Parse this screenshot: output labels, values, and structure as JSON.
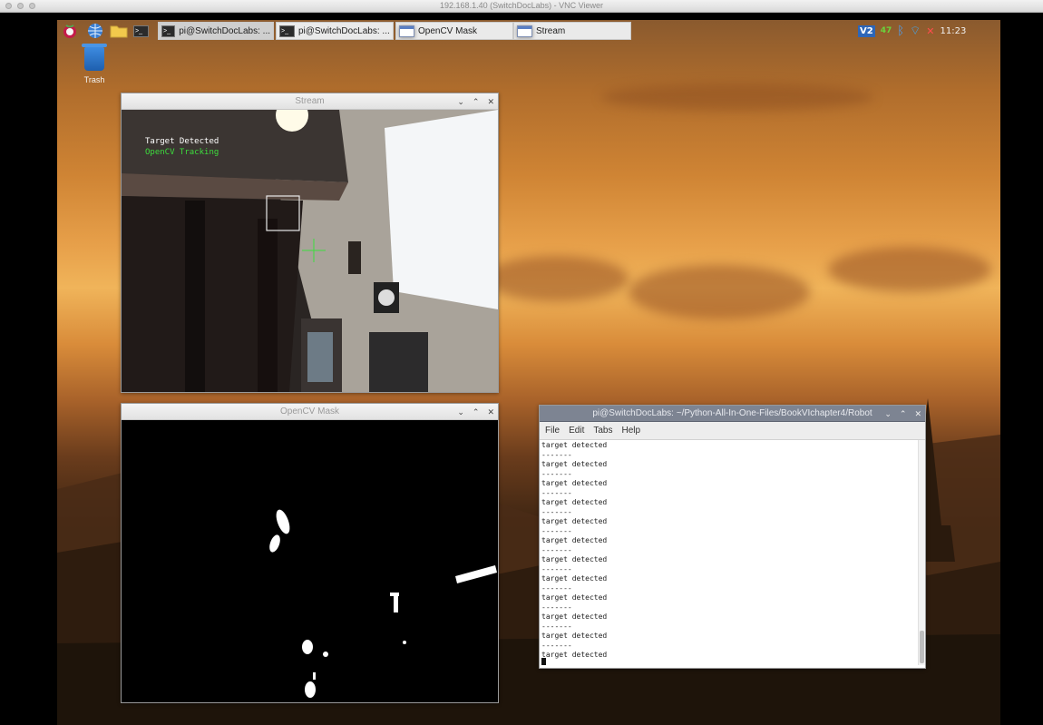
{
  "vnc": {
    "title": "192.168.1.40 (SwitchDocLabs) - VNC Viewer"
  },
  "taskbar": {
    "tasks": [
      {
        "label": "pi@SwitchDocLabs: ..."
      },
      {
        "label": "pi@SwitchDocLabs: ..."
      },
      {
        "label": "OpenCV Mask"
      },
      {
        "label": "Stream"
      }
    ],
    "clock": "11:23",
    "tray_vnc": "V2"
  },
  "desktop": {
    "trash_label": "Trash"
  },
  "stream": {
    "title": "Stream",
    "overlay_line1": "Target Detected",
    "overlay_line2": "OpenCV Tracking",
    "overlay_color1": "#ffffff",
    "overlay_color2": "#3ddc3d"
  },
  "mask": {
    "title": "OpenCV Mask"
  },
  "terminal": {
    "title": "pi@SwitchDocLabs: ~/Python-All-In-One-Files/BookVIchapter4/Robot",
    "menu": [
      "File",
      "Edit",
      "Tabs",
      "Help"
    ],
    "lines": [
      "target detected",
      "-------",
      "target detected",
      "-------",
      "target detected",
      "-------",
      "target detected",
      "-------",
      "target detected",
      "-------",
      "target detected",
      "-------",
      "target detected",
      "-------",
      "target detected",
      "-------",
      "target detected",
      "-------",
      "target detected",
      "-------",
      "target detected",
      "-------",
      "target detected"
    ]
  },
  "colors": {
    "accent_titlebar": "#7d8492",
    "terminal_bg": "#ffffff"
  }
}
